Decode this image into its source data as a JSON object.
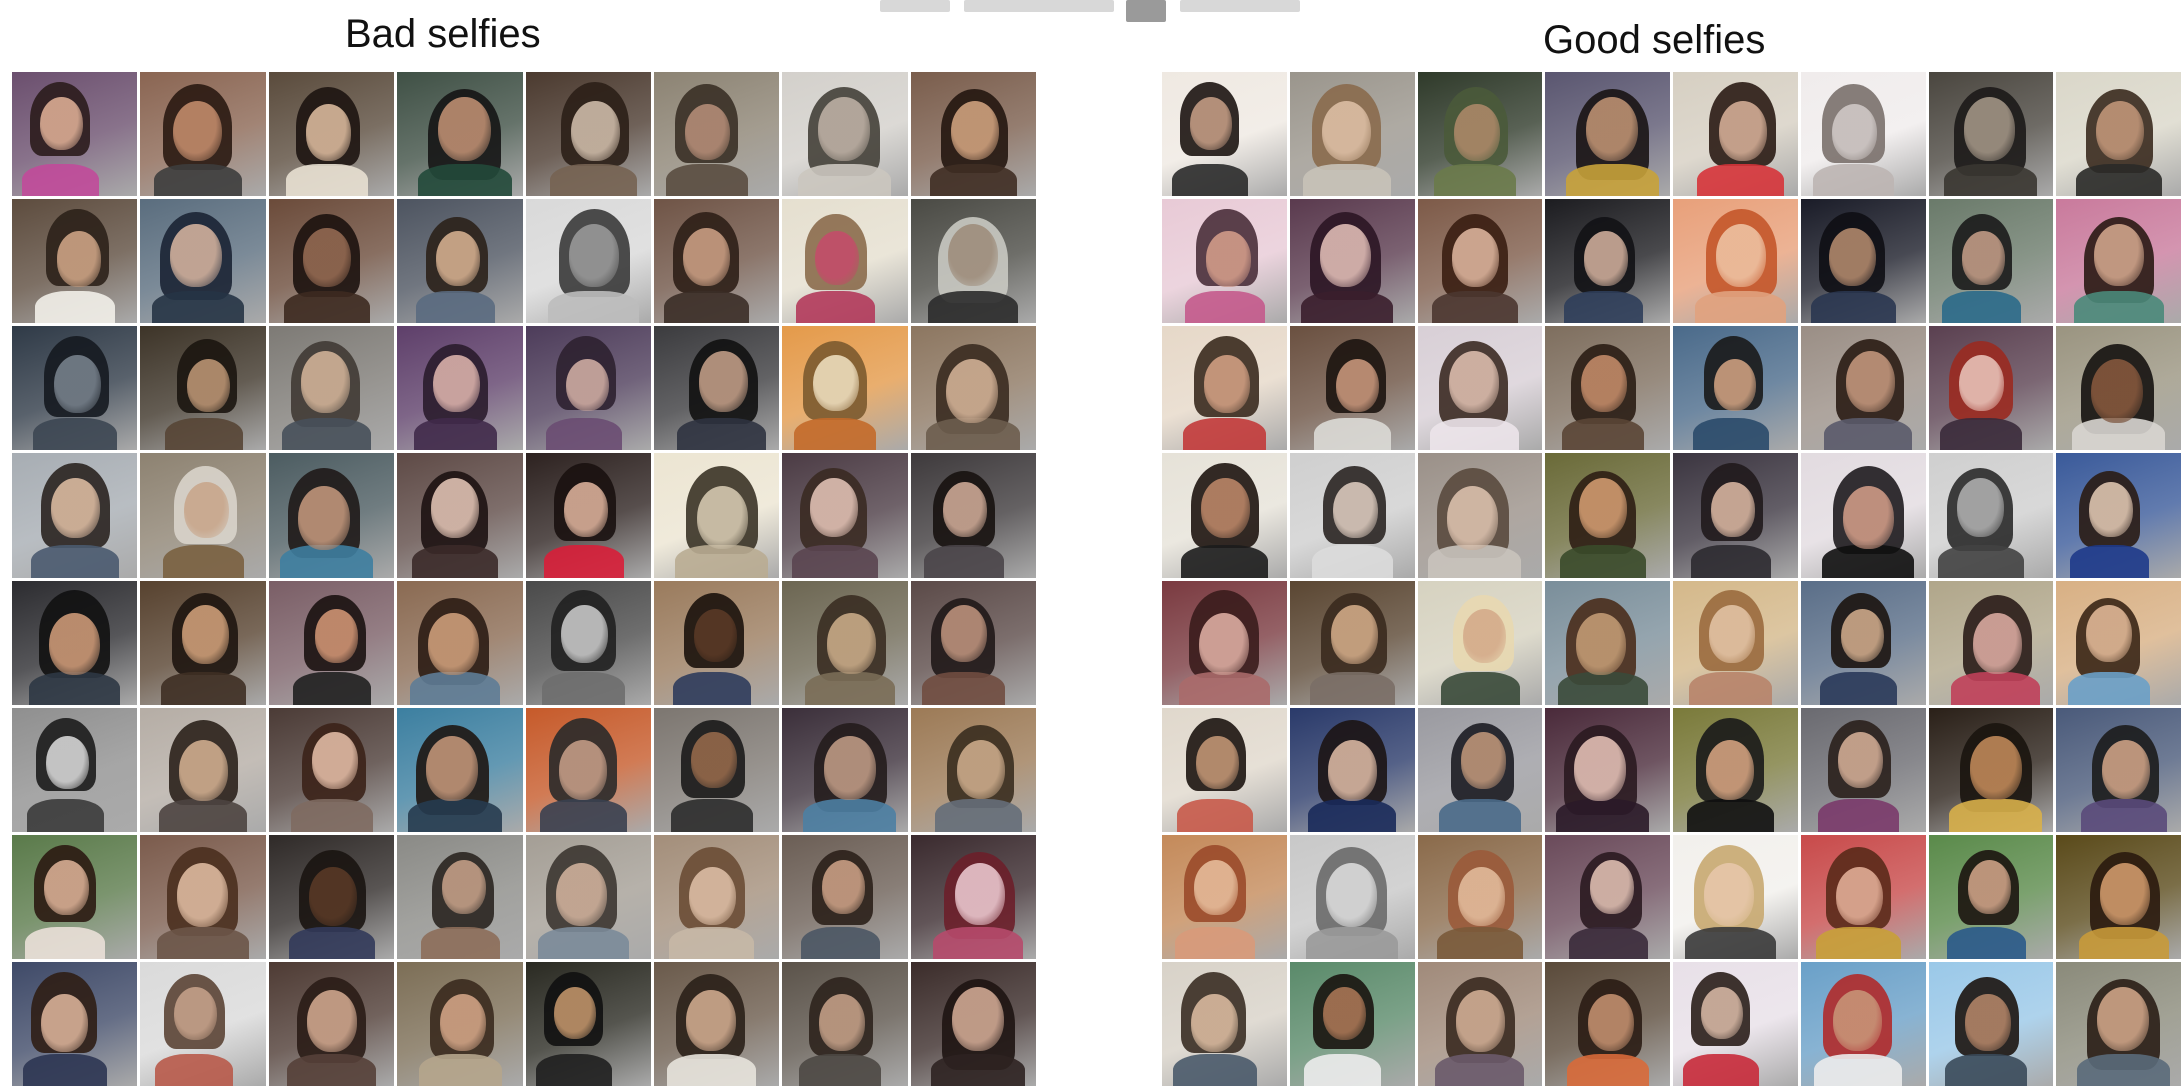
{
  "left_panel": {
    "title": "Bad selfies",
    "tiles": [
      {
        "bg": "#6b4f6e",
        "face": "#e4b49a",
        "hair": "#2b1c1c",
        "shirt": "#c14a9a"
      },
      {
        "bg": "#8a6552",
        "face": "#c9906f",
        "hair": "#2a1a12",
        "shirt": "#3d3d3d"
      },
      {
        "bg": "#5a4b3c",
        "face": "#e3c1a3",
        "hair": "#1d1411",
        "shirt": "#e8e0d2"
      },
      {
        "bg": "#3f5045",
        "face": "#c69476",
        "hair": "#151515",
        "shirt": "#22493a"
      },
      {
        "bg": "#4b3a2f",
        "face": "#d6c3b0",
        "hair": "#2b1f17",
        "shirt": "#756352"
      },
      {
        "bg": "#8c8373",
        "face": "#b9907a",
        "hair": "#3a3026",
        "shirt": "#5a4d40"
      },
      {
        "bg": "#d3d0cb",
        "face": "#c2b4a8",
        "hair": "#444039",
        "shirt": "#cbc6bf"
      },
      {
        "bg": "#7a5d4c",
        "face": "#d8a883",
        "hair": "#24160f",
        "shirt": "#3f2d24"
      },
      {
        "bg": "#5d4c3e",
        "face": "#d5aa8a",
        "hair": "#2c2119",
        "shirt": "#f2efe9"
      },
      {
        "bg": "#5a6d7e",
        "face": "#dbb8a2",
        "hair": "#1b2434",
        "shirt": "#263445"
      },
      {
        "bg": "#6b4b3a",
        "face": "#9a6e55",
        "hair": "#1c120e",
        "shirt": "#3d2a20"
      },
      {
        "bg": "#4d5460",
        "face": "#dcb594",
        "hair": "#2b2119",
        "shirt": "#5a6a80"
      },
      {
        "bg": "#d9d9d9",
        "face": "#9c9c9c",
        "hair": "#3a3a3a",
        "shirt": "#bdbdbd"
      },
      {
        "bg": "#6f5446",
        "face": "#d1a488",
        "hair": "#2d1f17",
        "shirt": "#3b2e27"
      },
      {
        "bg": "#e5dfcf",
        "face": "#c64a6a",
        "hair": "#8b6b4d",
        "shirt": "#b33a5b"
      },
      {
        "bg": "#4a4a44",
        "face": "#9c8a78",
        "hair": "#c9c9c2",
        "shirt": "#2b2b2b"
      },
      {
        "bg": "#2f3a47",
        "face": "#7b8590",
        "hair": "#151a20",
        "shirt": "#3c4652"
      },
      {
        "bg": "#3d3428",
        "face": "#c29a78",
        "hair": "#1b1510",
        "shirt": "#574535"
      },
      {
        "bg": "#7d7a75",
        "face": "#d8b89c",
        "hair": "#403a34",
        "shirt": "#47505a"
      },
      {
        "bg": "#5e3f6a",
        "face": "#e2b8b0",
        "hair": "#2a1c2c",
        "shirt": "#402a4a"
      },
      {
        "bg": "#4d3c5a",
        "face": "#d7b3a8",
        "hair": "#2e2130",
        "shirt": "#6a4c72"
      },
      {
        "bg": "#3b3b3e",
        "face": "#c9a38b",
        "hair": "#111111",
        "shirt": "#2f3340"
      },
      {
        "bg": "#e49a4a",
        "face": "#f2e3c4",
        "hair": "#7b5a2f",
        "shirt": "#c36a2a"
      },
      {
        "bg": "#8c7660",
        "face": "#d9b79b",
        "hair": "#3a2b20",
        "shirt": "#6d5d4e"
      },
      {
        "bg": "#a7adb3",
        "face": "#e3c1a6",
        "hair": "#2a2320",
        "shirt": "#4a5a6f"
      },
      {
        "bg": "#8d8271",
        "face": "#c7a488",
        "hair": "#d9d4cb",
        "shirt": "#7a6040"
      },
      {
        "bg": "#4c5c61",
        "face": "#c89b7f",
        "hair": "#1f1a18",
        "shirt": "#3e7ea0"
      },
      {
        "bg": "#5e4a46",
        "face": "#eacbbb",
        "hair": "#1d1212",
        "shirt": "#3b2a29"
      },
      {
        "bg": "#2d2220",
        "face": "#e3b7a0",
        "hair": "#1a1110",
        "shirt": "#d81e38"
      },
      {
        "bg": "#ece5d2",
        "face": "#dccfb6",
        "hair": "#3a3326",
        "shirt": "#b9ac92"
      },
      {
        "bg": "#4b3b44",
        "face": "#e9c8bb",
        "hair": "#3a2a22",
        "shirt": "#5a4550"
      },
      {
        "bg": "#3e3a3c",
        "face": "#d6b09c",
        "hair": "#17120f",
        "shirt": "#4a4549"
      },
      {
        "bg": "#2c2c30",
        "face": "#d6a07c",
        "hair": "#111111",
        "shirt": "#2e3744"
      },
      {
        "bg": "#57422f",
        "face": "#d6a57d",
        "hair": "#1e1510",
        "shirt": "#3e2f24"
      },
      {
        "bg": "#7a5e66",
        "face": "#d89a78",
        "hair": "#1b1211",
        "shirt": "#202020"
      },
      {
        "bg": "#8a6a52",
        "face": "#d5a47f",
        "hair": "#2b1c14",
        "shirt": "#5e7c96"
      },
      {
        "bg": "#4a4a4a",
        "face": "#cfcfcf",
        "hair": "#202020",
        "shirt": "#6e6e6e"
      },
      {
        "bg": "#9a7b5d",
        "face": "#5c3a26",
        "hair": "#1b120c",
        "shirt": "#2f3c5c"
      },
      {
        "bg": "#6c6652",
        "face": "#cfb08c",
        "hair": "#3a2d22",
        "shirt": "#7a6d57"
      },
      {
        "bg": "#5b4a48",
        "face": "#c39780",
        "hair": "#201818",
        "shirt": "#704c40"
      },
      {
        "bg": "#8f8f8f",
        "face": "#dedede",
        "hair": "#1c1c1c",
        "shirt": "#3b3b3b"
      },
      {
        "bg": "#b5ada5",
        "face": "#d8b494",
        "hair": "#2b211b",
        "shirt": "#4c4440"
      },
      {
        "bg": "#4b3b36",
        "face": "#e9c2ab",
        "hair": "#3b2218",
        "shirt": "#7e6a60"
      },
      {
        "bg": "#3c7fa0",
        "face": "#c99a7c",
        "hair": "#1e1612",
        "shirt": "#263b4f"
      },
      {
        "bg": "#c65a2a",
        "face": "#caa18a",
        "hair": "#2a2a2a",
        "shirt": "#3a4050"
      },
      {
        "bg": "#7c7670",
        "face": "#9a6c4c",
        "hair": "#1b1a1a",
        "shirt": "#2c2c2c"
      },
      {
        "bg": "#3b2f3a",
        "face": "#c6a089",
        "hair": "#241c1c",
        "shirt": "#4c7fa3"
      },
      {
        "bg": "#9c7a56",
        "face": "#d2b08f",
        "hair": "#3a2d1f",
        "shirt": "#656e79"
      },
      {
        "bg": "#5a7a4a",
        "face": "#e1b59a",
        "hair": "#2b1a12",
        "shirt": "#eae0d8"
      },
      {
        "bg": "#7b5b4c",
        "face": "#e5c1a6",
        "hair": "#4a2f1e",
        "shirt": "#6c5548"
      },
      {
        "bg": "#2f2a28",
        "face": "#5b3a26",
        "hair": "#1a1411",
        "shirt": "#323a5a"
      },
      {
        "bg": "#8a8a86",
        "face": "#caa48b",
        "hair": "#2a2520",
        "shirt": "#8d6e5a"
      },
      {
        "bg": "#a49e95",
        "face": "#d6b6a0",
        "hair": "#3c3631",
        "shirt": "#7b8b99"
      },
      {
        "bg": "#a38e7a",
        "face": "#e2c3aa",
        "hair": "#6a4d35",
        "shirt": "#c7b8a6"
      },
      {
        "bg": "#6b5e55",
        "face": "#d1a589",
        "hair": "#2b201a",
        "shirt": "#4b5664"
      },
      {
        "bg": "#3a2a2e",
        "face": "#f0cfd6",
        "hair": "#6b1f2a",
        "shirt": "#b64a6c"
      },
      {
        "bg": "#3f4a68",
        "face": "#e1b89e",
        "hair": "#2f1e15",
        "shirt": "#2c3552"
      },
      {
        "bg": "#dadada",
        "face": "#c9a48c",
        "hair": "#5b4435",
        "shirt": "#b85a4a"
      },
      {
        "bg": "#4e3b34",
        "face": "#d7ad93",
        "hair": "#2a1c16",
        "shirt": "#554039"
      },
      {
        "bg": "#7c6e56",
        "face": "#d8a98a",
        "hair": "#3a2a1e",
        "shirt": "#b5a58c"
      },
      {
        "bg": "#2a2a22",
        "face": "#c99a6e",
        "hair": "#111111",
        "shirt": "#1f1f1f"
      },
      {
        "bg": "#6a5a4b",
        "face": "#d7b093",
        "hair": "#2a2018",
        "shirt": "#e7e3dc"
      },
      {
        "bg": "#5b534a",
        "face": "#caa58c",
        "hair": "#2d241d",
        "shirt": "#4c4844"
      },
      {
        "bg": "#3b2c2a",
        "face": "#d9b09a",
        "hair": "#1e1412",
        "shirt": "#2d2221"
      }
    ]
  },
  "right_panel": {
    "title": "Good selfies",
    "tiles": [
      {
        "bg": "#efe9e2",
        "face": "#caa188",
        "hair": "#1c1411",
        "shirt": "#2a2a2a"
      },
      {
        "bg": "#9a958c",
        "face": "#e0c2a8",
        "hair": "#8a6a4c",
        "shirt": "#c8c2b8"
      },
      {
        "bg": "#2f3a2a",
        "face": "#b08a6a",
        "hair": "#4a5a3a",
        "shirt": "#6a7a4a"
      },
      {
        "bg": "#5a5670",
        "face": "#c59776",
        "hair": "#1a1414",
        "shirt": "#c8a23a"
      },
      {
        "bg": "#d6cfc2",
        "face": "#dbb39b",
        "hair": "#2a1b14",
        "shirt": "#d6343a"
      },
      {
        "bg": "#f0ecec",
        "face": "#d3ccca",
        "hair": "#7a706c",
        "shirt": "#bdb5b2"
      },
      {
        "bg": "#4a463f",
        "face": "#a89a8a",
        "hair": "#1c1a18",
        "shirt": "#3a3631"
      },
      {
        "bg": "#dad7c9",
        "face": "#c79a7c",
        "hair": "#3a2a1e",
        "shirt": "#2a2a28"
      },
      {
        "bg": "#e8cad6",
        "face": "#d8a08c",
        "hair": "#4a2f3a",
        "shirt": "#c45a8c"
      },
      {
        "bg": "#5a3a4e",
        "face": "#e8c4bc",
        "hair": "#2b1524",
        "shirt": "#3a1e2c"
      },
      {
        "bg": "#7d5a48",
        "face": "#e3baa2",
        "hair": "#3a1e12",
        "shirt": "#4b3630"
      },
      {
        "bg": "#1c1c20",
        "face": "#d7b4a0",
        "hair": "#121215",
        "shirt": "#2f3e5a"
      },
      {
        "bg": "#e8a07a",
        "face": "#f0c7a8",
        "hair": "#c4562a",
        "shirt": "#e0a27e"
      },
      {
        "bg": "#1a1c28",
        "face": "#b98e70",
        "hair": "#0e0e14",
        "shirt": "#2a3650"
      },
      {
        "bg": "#6a7a6a",
        "face": "#c9a18a",
        "hair": "#1b1b1b",
        "shirt": "#2b6a8a"
      },
      {
        "bg": "#c97a9c",
        "face": "#d8ab90",
        "hair": "#2a1a14",
        "shirt": "#4a8a7a"
      },
      {
        "bg": "#e6d8c8",
        "face": "#d7a386",
        "hair": "#3a2a1e",
        "shirt": "#c23a3a"
      },
      {
        "bg": "#6a5040",
        "face": "#cf9c80",
        "hair": "#1c1410",
        "shirt": "#dcdad6"
      },
      {
        "bg": "#d8cfd6",
        "face": "#e3c3b3",
        "hair": "#3b2a22",
        "shirt": "#ece4ea"
      },
      {
        "bg": "#7e6e5e",
        "face": "#c98f6c",
        "hair": "#2a1d14",
        "shirt": "#5a4535"
      },
      {
        "bg": "#4a6a8a",
        "face": "#d6a684",
        "hair": "#1a1a1a",
        "shirt": "#2a4a6a"
      },
      {
        "bg": "#9a8e85",
        "face": "#c99b80",
        "hair": "#2a1c14",
        "shirt": "#5a5a6a"
      },
      {
        "bg": "#5a4050",
        "face": "#ecc9bf",
        "hair": "#9a2a20",
        "shirt": "#3a2a3a"
      },
      {
        "bg": "#9a9480",
        "face": "#8a5a3e",
        "hair": "#151210",
        "shirt": "#d8d5d0"
      },
      {
        "bg": "#e6e2d8",
        "face": "#c18a6a",
        "hair": "#1e1410",
        "shirt": "#1c1c1c"
      },
      {
        "bg": "#cfcfcf",
        "face": "#e2d0c3",
        "hair": "#2a2522",
        "shirt": "#dcdcdc"
      },
      {
        "bg": "#9a9088",
        "face": "#e1c6b2",
        "hair": "#5a4a3e",
        "shirt": "#c9c3bd"
      },
      {
        "bg": "#6a6a38",
        "face": "#d8a074",
        "hair": "#2e1e14",
        "shirt": "#3a4a2a"
      },
      {
        "bg": "#3b3540",
        "face": "#e0bca6",
        "hair": "#201a1c",
        "shirt": "#2c2a30"
      },
      {
        "bg": "#e2dbe0",
        "face": "#d7a08a",
        "hair": "#1e1b1e",
        "shirt": "#101010"
      },
      {
        "bg": "#cfcfcf",
        "face": "#b3b3b3",
        "hair": "#2a2a2a",
        "shirt": "#424242"
      },
      {
        "bg": "#3a5a9a",
        "face": "#e7cdb7",
        "hair": "#2a1c14",
        "shirt": "#1e3a8a"
      },
      {
        "bg": "#7a3a40",
        "face": "#e4b4a8",
        "hair": "#3a1c1c",
        "shirt": "#aa6a6a"
      },
      {
        "bg": "#5a4632",
        "face": "#d8b08c",
        "hair": "#3a2a1e",
        "shirt": "#7a6e66"
      },
      {
        "bg": "#d6d2c0",
        "face": "#d3a888",
        "hair": "#e8d8b0",
        "shirt": "#3a4a3a"
      },
      {
        "bg": "#7a8e9a",
        "face": "#c8a078",
        "hair": "#4a2e1c",
        "shirt": "#3a4a3a"
      },
      {
        "bg": "#d4b88a",
        "face": "#e5c6a8",
        "hair": "#9a6a3e",
        "shirt": "#b8846a"
      },
      {
        "bg": "#5a6e88",
        "face": "#d6b08f",
        "hair": "#1c1410",
        "shirt": "#2a3a5a"
      },
      {
        "bg": "#b0a68a",
        "face": "#e2b0a6",
        "hair": "#2a1c18",
        "shirt": "#c0405a"
      },
      {
        "bg": "#d8b084",
        "face": "#e8be9c",
        "hair": "#3a2616",
        "shirt": "#6aa0c8"
      },
      {
        "bg": "#e0d8cc",
        "face": "#c89a78",
        "hair": "#1c1410",
        "shirt": "#c85a4a"
      },
      {
        "bg": "#2a3a6a",
        "face": "#e2bea8",
        "hair": "#1c1414",
        "shirt": "#1a2a5a"
      },
      {
        "bg": "#9a9aa0",
        "face": "#c49a7c",
        "hair": "#1c1c22",
        "shirt": "#4a6a8a"
      },
      {
        "bg": "#4a2a3a",
        "face": "#ecc8bc",
        "hair": "#2a1a20",
        "shirt": "#2a1a28"
      },
      {
        "bg": "#7a7a3a",
        "face": "#dca884",
        "hair": "#1a1a1a",
        "shirt": "#101010"
      },
      {
        "bg": "#6a6a70",
        "face": "#d9b29a",
        "hair": "#2a201c",
        "shirt": "#7a3a6a"
      },
      {
        "bg": "#2a2018",
        "face": "#c88e5c",
        "hair": "#1a140e",
        "shirt": "#d8b04a"
      },
      {
        "bg": "#4a5a7a",
        "face": "#d6a88a",
        "hair": "#1c1c1c",
        "shirt": "#5a4a7a"
      },
      {
        "bg": "#c48a5a",
        "face": "#eac2a0",
        "hair": "#9a4a2a",
        "shirt": "#d89a7a"
      },
      {
        "bg": "#c8c8c8",
        "face": "#e0e0e0",
        "hair": "#6a6a6a",
        "shirt": "#9a9a9a"
      },
      {
        "bg": "#8a6a4a",
        "face": "#e6c0a0",
        "hair": "#9a5a3a",
        "shirt": "#7a5a3a"
      },
      {
        "bg": "#6a4a5a",
        "face": "#e7c6b8",
        "hair": "#2a1a20",
        "shirt": "#3a2a3a"
      },
      {
        "bg": "#f2f0ec",
        "face": "#e8c8ac",
        "hair": "#c8a870",
        "shirt": "#3a3a3a"
      },
      {
        "bg": "#c84a4a",
        "face": "#e8b49c",
        "hair": "#5a2a1a",
        "shirt": "#c8a038"
      },
      {
        "bg": "#5a8a4a",
        "face": "#d6a88c",
        "hair": "#1c1410",
        "shirt": "#2a5a8a"
      },
      {
        "bg": "#5a4a1a",
        "face": "#d8a070",
        "hair": "#2a1a0e",
        "shirt": "#c89a3a"
      },
      {
        "bg": "#d8d2c8",
        "face": "#e0c0a4",
        "hair": "#3a2e24",
        "shirt": "#4a5a6a"
      },
      {
        "bg": "#5a8a6a",
        "face": "#b07a58",
        "hair": "#1a1410",
        "shirt": "#ececec"
      },
      {
        "bg": "#a08a7a",
        "face": "#d8b49a",
        "hair": "#3a2a20",
        "shirt": "#6a5a6a"
      },
      {
        "bg": "#5a4a3a",
        "face": "#c99472",
        "hair": "#2a1c14",
        "shirt": "#d86a3a"
      },
      {
        "bg": "#e8e0e8",
        "face": "#dcbca8",
        "hair": "#2a1e1a",
        "shirt": "#c82a3a"
      },
      {
        "bg": "#6aa0c8",
        "face": "#c9987a",
        "hair": "#b02a2a",
        "shirt": "#ececec"
      },
      {
        "bg": "#9ac8e8",
        "face": "#b8886a",
        "hair": "#1c1410",
        "shirt": "#3a4a5a"
      },
      {
        "bg": "#8a8a7a",
        "face": "#d6aa8c",
        "hair": "#2a1e16",
        "shirt": "#5a6a7a"
      }
    ]
  },
  "colors": {
    "background": "#ffffff",
    "title_text": "#111111"
  }
}
